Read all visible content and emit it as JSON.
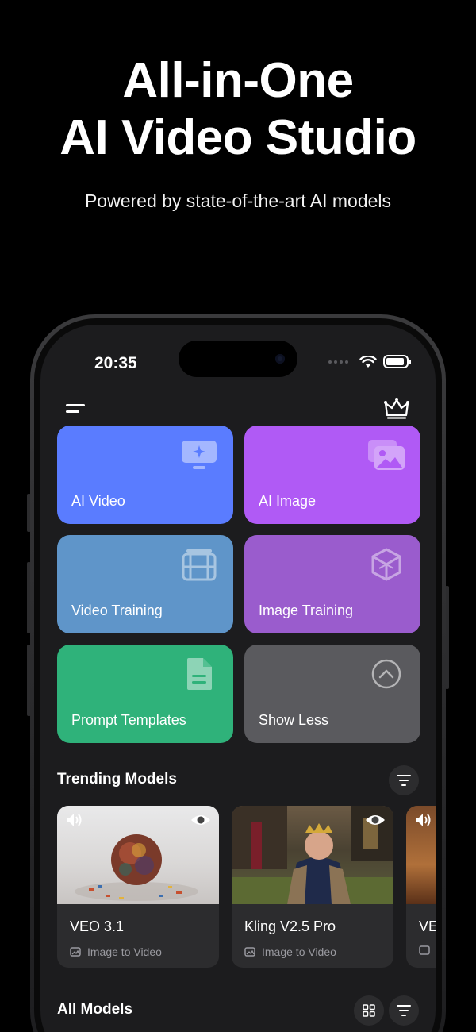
{
  "hero": {
    "title_line1": "All-in-One",
    "title_line2": "AI Video Studio",
    "subtitle": "Powered by state-of-the-art AI models"
  },
  "status_bar": {
    "time": "20:35",
    "battery_level": 0.9
  },
  "header": {
    "menu_icon": "hamburger-icon",
    "premium_icon": "crown-icon"
  },
  "tiles": [
    {
      "label": "AI Video",
      "icon": "monitor-sparkle-icon",
      "color": "#5a7cff"
    },
    {
      "label": "AI Image",
      "icon": "images-icon",
      "color": "#b05af5"
    },
    {
      "label": "Video Training",
      "icon": "film-icon",
      "color": "#5f95c9"
    },
    {
      "label": "Image Training",
      "icon": "cube-icon",
      "color": "#9a5ccd"
    },
    {
      "label": "Prompt Templates",
      "icon": "document-icon",
      "color": "#2fb27a"
    },
    {
      "label": "Show Less",
      "icon": "chevron-up-circle-icon",
      "color": "#5a5a5e"
    }
  ],
  "trending": {
    "title": "Trending Models",
    "filter_icon": "filter-icon",
    "models": [
      {
        "name": "VEO 3.1",
        "type": "Image to Video"
      },
      {
        "name": "Kling V2.5 Pro",
        "type": "Image to Video"
      },
      {
        "name": "VE",
        "type": ""
      }
    ]
  },
  "all_models": {
    "title": "All Models",
    "grid_icon": "grid-icon",
    "filter_icon": "filter-icon"
  }
}
